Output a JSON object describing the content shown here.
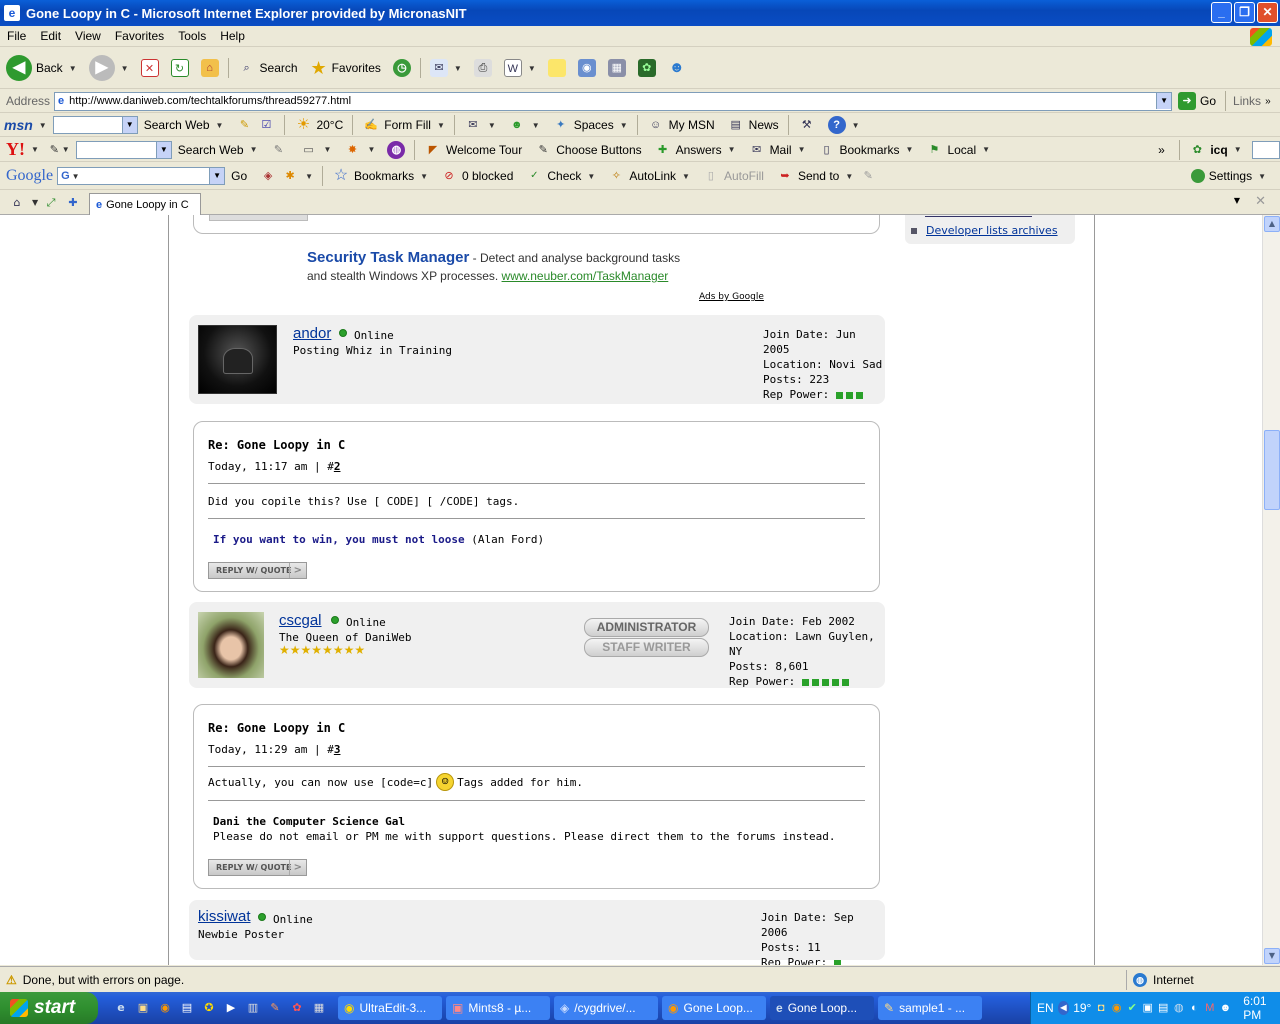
{
  "window": {
    "title": "Gone Loopy in C - Microsoft Internet Explorer provided by MicronasNIT"
  },
  "menu": [
    "File",
    "Edit",
    "View",
    "Favorites",
    "Tools",
    "Help"
  ],
  "std_toolbar": {
    "back": "Back",
    "search": "Search",
    "favorites": "Favorites"
  },
  "address": {
    "label": "Address",
    "url": "http://www.daniweb.com/techtalkforums/thread59277.html",
    "go": "Go",
    "links": "Links"
  },
  "msn_bar": {
    "logo": "msn",
    "search_web": "Search Web",
    "weather": "20°C",
    "form_fill": "Form Fill",
    "spaces": "Spaces",
    "my_msn": "My MSN",
    "news": "News"
  },
  "yahoo_bar": {
    "logo": "Y!",
    "search_web": "Search Web",
    "welcome_tour": "Welcome Tour",
    "choose_buttons": "Choose Buttons",
    "answers": "Answers",
    "mail": "Mail",
    "bookmarks": "Bookmarks",
    "local": "Local",
    "icq": "icq"
  },
  "google_bar": {
    "logo": "Google",
    "go": "Go",
    "bookmarks": "Bookmarks",
    "blocked": "0 blocked",
    "check": "Check",
    "autolink": "AutoLink",
    "autofill": "AutoFill",
    "send_to": "Send to",
    "settings": "Settings"
  },
  "tab": {
    "title": "Gone Loopy in C"
  },
  "sidebar": {
    "link": "Developer lists archives"
  },
  "ad": {
    "title": "Security Task Manager",
    "line1": " - Detect and analyse background tasks",
    "line2": "and stealth Windows XP processes. ",
    "url": "www.neuber.com/TaskManager",
    "ads_by": "Ads by Google"
  },
  "posts": [
    {
      "user": "andor",
      "status": "Online",
      "rank": "Posting Whiz in Training",
      "join": "Join Date: Jun 2005",
      "location": "Location: Novi Sad",
      "posts": "Posts: 223",
      "rep_label": "Rep Power:",
      "rep_power": 3,
      "title": "Re: Gone Loopy in C",
      "time": "Today, 11:17 am | #",
      "num": "2",
      "body": "Did you copile this? Use [ CODE] [ /CODE] tags.",
      "sig_bold": "If you want to win, you must not loose",
      "sig_rest": " (Alan Ford)",
      "reply": "REPLY W/ QUOTE"
    },
    {
      "user": "cscgal",
      "status": "Online",
      "rank": "The Queen of DaniWeb",
      "stars": 8,
      "badge1": "ADMINISTRATOR",
      "badge2": "STAFF WRITER",
      "join": "Join Date: Feb 2002",
      "location": "Location: Lawn Guylen, NY",
      "posts": "Posts: 8,601",
      "rep_label": "Rep Power:",
      "rep_power": 5,
      "title": "Re: Gone Loopy in C",
      "time": "Today, 11:29 am | #",
      "num": "3",
      "body_a": "Actually, you can now use [code=c]",
      "body_b": " Tags added for him.",
      "sig_bold": "Dani the Computer Science Gal",
      "sig_line": "Please do not email or PM me with support questions. Please direct them to the forums instead.",
      "reply": "REPLY W/ QUOTE"
    },
    {
      "user": "kissiwat",
      "status": "Online",
      "rank": "Newbie Poster",
      "join": "Join Date: Sep 2006",
      "posts": "Posts: 11",
      "rep_label": "Rep Power:",
      "rep_power": 1
    }
  ],
  "status": {
    "text": "Done, but with errors on page.",
    "zone": "Internet"
  },
  "taskbar": {
    "start": "start",
    "tasks": [
      "UltraEdit-3...",
      "Mints8 - µ...",
      "/cygdrive/...",
      "Gone Loop...",
      "Gone Loop...",
      "sample1 - ..."
    ],
    "lang": "EN",
    "temp": "19°",
    "clock": "6:01 PM"
  }
}
